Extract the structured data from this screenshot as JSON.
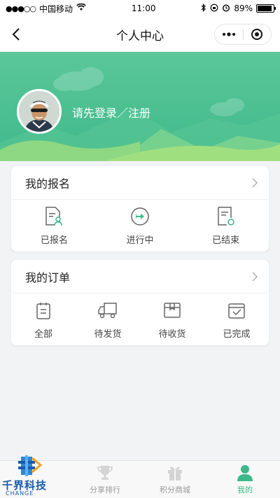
{
  "status_bar": {
    "signal": "●●●○○",
    "carrier": "中国移动",
    "time": "11:00",
    "battery": "89%",
    "battery_level": 0.89
  },
  "nav": {
    "title": "个人中心"
  },
  "profile": {
    "login_text": "请先登录／注册"
  },
  "registration": {
    "title": "我的报名",
    "items": [
      {
        "label": "已报名",
        "icon": "registered-doc-icon"
      },
      {
        "label": "进行中",
        "icon": "in-progress-icon"
      },
      {
        "label": "已结束",
        "icon": "ended-doc-icon"
      }
    ]
  },
  "orders": {
    "title": "我的订单",
    "items": [
      {
        "label": "全部",
        "icon": "all-orders-icon"
      },
      {
        "label": "待发货",
        "icon": "truck-icon"
      },
      {
        "label": "待收货",
        "icon": "package-icon"
      },
      {
        "label": "已完成",
        "icon": "completed-icon"
      }
    ]
  },
  "tabbar": {
    "items": [
      {
        "label": "",
        "icon": "home-icon"
      },
      {
        "label": "分享排行",
        "icon": "trophy-icon"
      },
      {
        "label": "积分商城",
        "icon": "gift-icon"
      },
      {
        "label": "我的",
        "icon": "user-icon",
        "active": true
      }
    ]
  },
  "watermark": {
    "text": "千界科技",
    "sub": "CHANGE"
  },
  "colors": {
    "accent": "#3db88a",
    "hero_top": "#5bc79a",
    "icon_gray": "#666666"
  }
}
